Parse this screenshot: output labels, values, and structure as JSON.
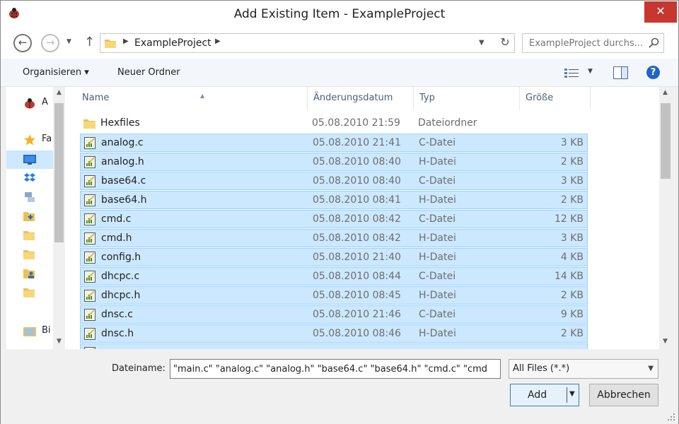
{
  "window": {
    "title": "Add Existing Item - ExampleProject",
    "close_glyph": "✕"
  },
  "address": {
    "crumb": "ExampleProject",
    "search_placeholder": "ExampleProject durchs..."
  },
  "toolbar": {
    "organize_label": "Organisieren ▾",
    "new_folder_label": "Neuer Ordner"
  },
  "navpane": {
    "items": [
      {
        "label": "A",
        "icon": "ladybug-icon"
      },
      {
        "label": "Fa",
        "icon": "star-icon"
      },
      {
        "label": "",
        "icon": "desktop-icon"
      },
      {
        "label": "",
        "icon": "dropbox-icon"
      },
      {
        "label": "",
        "icon": "network-icon"
      },
      {
        "label": "",
        "icon": "downloads-folder-icon"
      },
      {
        "label": "",
        "icon": "folder-icon"
      },
      {
        "label": "",
        "icon": "folder-icon"
      },
      {
        "label": "",
        "icon": "user-folder-icon"
      },
      {
        "label": "",
        "icon": "folder-icon"
      },
      {
        "label": "Bi",
        "icon": "libraries-icon"
      }
    ]
  },
  "columns": {
    "name": "Name",
    "date": "Änderungsdatum",
    "type": "Typ",
    "size": "Größe"
  },
  "files": [
    {
      "name": "Hexfiles",
      "date": "05.08.2010 21:59",
      "type": "Dateiordner",
      "size": "",
      "selected": false,
      "icon": "folder-icon"
    },
    {
      "name": "analog.c",
      "date": "05.08.2010 21:41",
      "type": "C-Datei",
      "size": "3 KB",
      "selected": true,
      "icon": "source-file-icon"
    },
    {
      "name": "analog.h",
      "date": "05.08.2010 08:40",
      "type": "H-Datei",
      "size": "2 KB",
      "selected": true,
      "icon": "source-file-icon"
    },
    {
      "name": "base64.c",
      "date": "05.08.2010 08:40",
      "type": "C-Datei",
      "size": "3 KB",
      "selected": true,
      "icon": "source-file-icon"
    },
    {
      "name": "base64.h",
      "date": "05.08.2010 08:41",
      "type": "H-Datei",
      "size": "2 KB",
      "selected": true,
      "icon": "source-file-icon"
    },
    {
      "name": "cmd.c",
      "date": "05.08.2010 08:42",
      "type": "C-Datei",
      "size": "12 KB",
      "selected": true,
      "icon": "source-file-icon"
    },
    {
      "name": "cmd.h",
      "date": "05.08.2010 08:42",
      "type": "H-Datei",
      "size": "3 KB",
      "selected": true,
      "icon": "source-file-icon"
    },
    {
      "name": "config.h",
      "date": "05.08.2010 21:40",
      "type": "H-Datei",
      "size": "4 KB",
      "selected": true,
      "icon": "source-file-icon"
    },
    {
      "name": "dhcpc.c",
      "date": "05.08.2010 08:44",
      "type": "C-Datei",
      "size": "14 KB",
      "selected": true,
      "icon": "source-file-icon"
    },
    {
      "name": "dhcpc.h",
      "date": "05.08.2010 08:45",
      "type": "H-Datei",
      "size": "2 KB",
      "selected": true,
      "icon": "source-file-icon"
    },
    {
      "name": "dnsc.c",
      "date": "05.08.2010 21:46",
      "type": "C-Datei",
      "size": "9 KB",
      "selected": true,
      "icon": "source-file-icon"
    },
    {
      "name": "dnsc.h",
      "date": "05.08.2010 08:46",
      "type": "H-Datei",
      "size": "2 KB",
      "selected": true,
      "icon": "source-file-icon"
    },
    {
      "name": "",
      "date": "",
      "type": "",
      "size": "",
      "selected": true,
      "icon": "source-file-icon"
    }
  ],
  "bottom": {
    "filename_label": "Dateiname:",
    "filename_value": "\"main.c\" \"analog.c\" \"analog.h\" \"base64.c\" \"base64.h\" \"cmd.c\" \"cmd",
    "filter_value": "All Files (*.*)",
    "add_label": "Add",
    "cancel_label": "Abbrechen"
  },
  "colors": {
    "selection_bg": "#cce8ff",
    "selection_border": "#99d1ff",
    "close_red": "#c7372f",
    "help_blue": "#1f64c7"
  }
}
